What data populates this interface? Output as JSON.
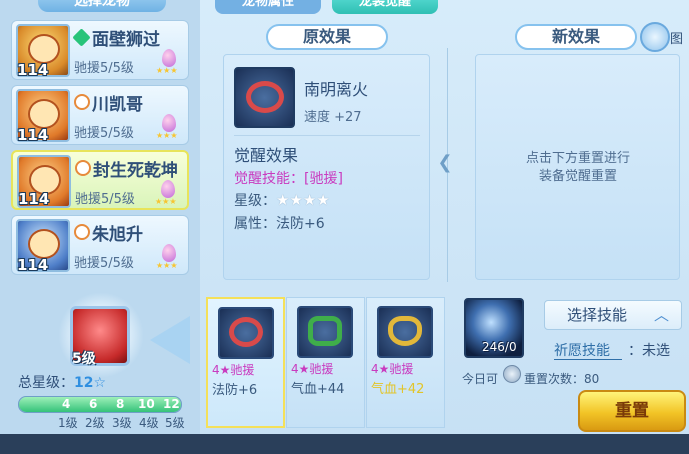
{
  "left_panel": {
    "header": "选择龙物",
    "pets": [
      {
        "name": "面壁狮过",
        "level": "114",
        "assist": "驰援5/5级",
        "type": "green"
      },
      {
        "name": "川凯哥",
        "level": "114",
        "assist": "驰援5/5级",
        "type": "orange"
      },
      {
        "name": "封生死乾坤",
        "level": "114",
        "assist": "驰援5/5级",
        "type": "orange",
        "selected": true
      },
      {
        "name": "朱旭升",
        "level": "114",
        "assist": "驰援5/5级",
        "type": "orange"
      }
    ],
    "level_card": "5级",
    "total_star_label": "总星级：",
    "total_star_value": "12☆",
    "bar_numbers": [
      "4",
      "6",
      "8",
      "10",
      "12"
    ],
    "bar_levels": [
      "1级",
      "2级",
      "3级",
      "4级",
      "5级"
    ],
    "bar_progress": 1.0
  },
  "tabs": {
    "attr": "龙物属性",
    "equip": "龙装觉醒"
  },
  "original_effect": {
    "header": "原效果",
    "equip_name": "南明离火",
    "equip_speed": "速度 +27",
    "awaken_title": "觉醒效果",
    "awaken_skill": "觉醒技能：[驰援]",
    "star_label": "星级：",
    "star_value": "★★★★",
    "attr": "属性：法防+6"
  },
  "new_effect": {
    "header": "新效果",
    "hint_line1": "点击下方重置进行",
    "hint_line2": "装备觉醒重置",
    "catalog_label": "图"
  },
  "equip_slots": [
    {
      "tag": "4★驰援",
      "value": "法防+6",
      "ring": "red",
      "selected": true
    },
    {
      "tag": "4★驰援",
      "value": "气血+44",
      "ring": "green",
      "selected": false
    },
    {
      "tag": "4★驰援",
      "value": "气血+42",
      "ring": "gold",
      "selected": false
    }
  ],
  "skill_reset": {
    "count": "246/0",
    "select_skill": "选择技能",
    "chevron": "︿",
    "wish_label": "祈愿技能",
    "wish_value": "：未选",
    "today_label": "今日可",
    "reset_count": "重置次数：80",
    "reset_button": "重置"
  }
}
